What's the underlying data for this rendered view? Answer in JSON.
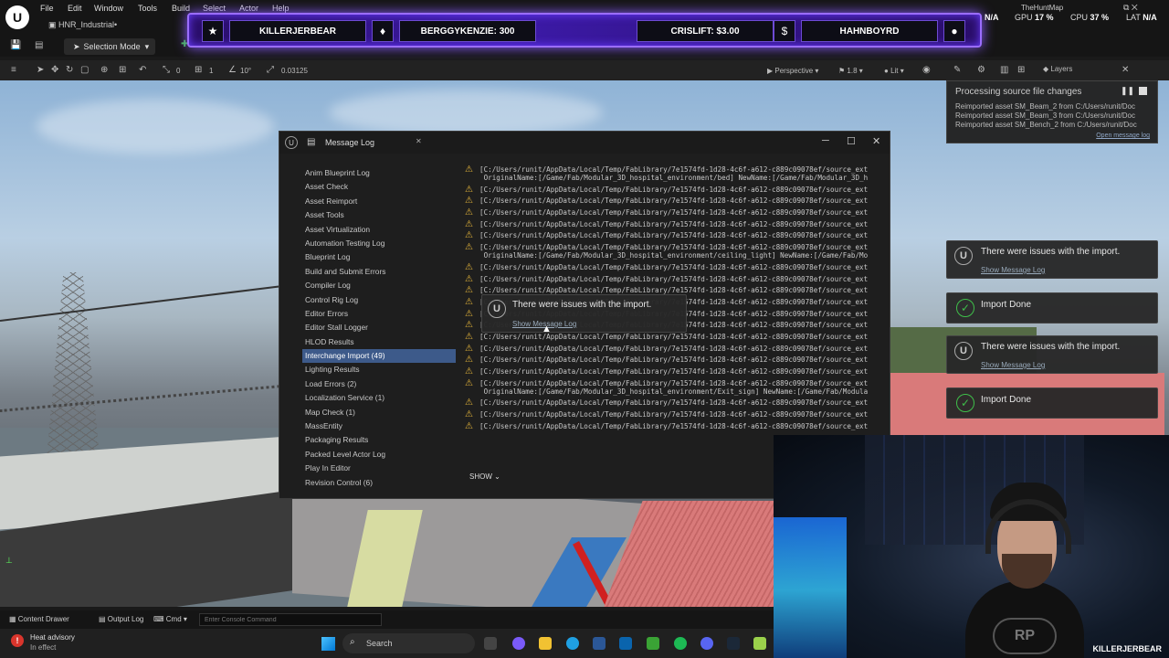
{
  "app": {
    "project_tab": "HNR_Industrial•",
    "menu": [
      "File",
      "Edit",
      "Window",
      "Tools",
      "Build",
      "Select",
      "Actor",
      "Help"
    ],
    "mode": "Selection Mode",
    "map_name": "TheHuntMap"
  },
  "toolbar": {
    "snap_grid": "0",
    "snap_rot": "1",
    "rot_step": "10°",
    "scale_step": "0.03125",
    "perspective": "Perspective",
    "cam_speed": "1.8",
    "lit": "Lit",
    "layers": "Layers"
  },
  "stats": {
    "ping_value": "N/A",
    "gpu_label": "GPU",
    "gpu_value": "17 %",
    "cpu_label": "CPU",
    "cpu_value": "37 %",
    "lat_label": "LAT",
    "lat_value": "N/A"
  },
  "banner": {
    "items": [
      "KILLERJERBEAR",
      "BERGGYKENZIE: 300",
      "CRISLIFT: $3.00",
      "HAHNBOYRD"
    ]
  },
  "message_log": {
    "title": "Message Log",
    "categories": [
      "Anim Blueprint Log",
      "Asset Check",
      "Asset Reimport",
      "Asset Tools",
      "Asset Virtualization",
      "Automation Testing Log",
      "Blueprint Log",
      "Build and Submit Errors",
      "Compiler Log",
      "Control Rig Log",
      "Editor Errors",
      "Editor Stall Logger",
      "HLOD Results",
      "Interchange Import (49)",
      "Lighting Results",
      "Load Errors (2)",
      "Localization Service (1)",
      "Map Check (1)",
      "MassEntity",
      "Packaging Results",
      "Packed Level Actor Log",
      "Play In Editor",
      "Revision Control (6)"
    ],
    "selected_index": 13,
    "lines": [
      "[C:/Users/runit/AppData/Local/Temp/FabLibrary/7e1574fd-1d28-4c6f-a612-c889c09078ef/source_ext\n OriginalName:[/Game/Fab/Modular_3D_hospital_environment/bed] NewName:[/Game/Fab/Modular_3D_h",
      "[C:/Users/runit/AppData/Local/Temp/FabLibrary/7e1574fd-1d28-4c6f-a612-c889c09078ef/source_ext",
      "[C:/Users/runit/AppData/Local/Temp/FabLibrary/7e1574fd-1d28-4c6f-a612-c889c09078ef/source_ext",
      "[C:/Users/runit/AppData/Local/Temp/FabLibrary/7e1574fd-1d28-4c6f-a612-c889c09078ef/source_ext",
      "[C:/Users/runit/AppData/Local/Temp/FabLibrary/7e1574fd-1d28-4c6f-a612-c889c09078ef/source_ext",
      "[C:/Users/runit/AppData/Local/Temp/FabLibrary/7e1574fd-1d28-4c6f-a612-c889c09078ef/source_ext",
      "[C:/Users/runit/AppData/Local/Temp/FabLibrary/7e1574fd-1d28-4c6f-a612-c889c09078ef/source_ext\n OriginalName:[/Game/Fab/Modular_3D_hospital_environment/ceiling_light] NewName:[/Game/Fab/Mo",
      "[C:/Users/runit/AppData/Local/Temp/FabLibrary/7e1574fd-1d28-4c6f-a612-c889c09078ef/source_ext",
      "[C:/Users/runit/AppData/Local/Temp/FabLibrary/7e1574fd-1d28-4c6f-a612-c889c09078ef/source_ext",
      "[C:/Users/runit/AppData/Local/Temp/FabLibrary/7e1574fd-1d28-4c6f-a612-c889c09078ef/source_ext",
      "[C:/Users/runit/AppData/Local/Temp/FabLibrary/7e1574fd-1d28-4c6f-a612-c889c09078ef/source_ext",
      "[C:/Users/runit/AppData/Local/Temp/FabLibrary/7e1574fd-1d28-4c6f-a612-c889c09078ef/source_ext",
      "[C:/Users/runit/AppData/Local/Temp/FabLibrary/7e1574fd-1d28-4c6f-a612-c889c09078ef/source_ext",
      "[C:/Users/runit/AppData/Local/Temp/FabLibrary/7e1574fd-1d28-4c6f-a612-c889c09078ef/source_ext",
      "[C:/Users/runit/AppData/Local/Temp/FabLibrary/7e1574fd-1d28-4c6f-a612-c889c09078ef/source_ext",
      "[C:/Users/runit/AppData/Local/Temp/FabLibrary/7e1574fd-1d28-4c6f-a612-c889c09078ef/source_ext",
      "[C:/Users/runit/AppData/Local/Temp/FabLibrary/7e1574fd-1d28-4c6f-a612-c889c09078ef/source_ext",
      "[C:/Users/runit/AppData/Local/Temp/FabLibrary/7e1574fd-1d28-4c6f-a612-c889c09078ef/source_ext\n OriginalName:[/Game/Fab/Modular_3D_hospital_environment/Exit_sign] NewName:[/Game/Fab/Modula",
      "[C:/Users/runit/AppData/Local/Temp/FabLibrary/7e1574fd-1d28-4c6f-a612-c889c09078ef/source_ext",
      "[C:/Users/runit/AppData/Local/Temp/FabLibrary/7e1574fd-1d28-4c6f-a612-c889c09078ef/source_ext",
      "[C:/Users/runit/AppData/Local/Temp/FabLibrary/7e1574fd-1d28-4c6f-a612-c889c09078ef/source_ext"
    ],
    "show_button": "SHOW"
  },
  "inline_toast": {
    "title": "There were issues with the import.",
    "link": "Show Message Log"
  },
  "processing": {
    "title": "Processing source file changes",
    "lines": [
      "Reimported asset SM_Beam_2 from C:/Users/runit/Doc",
      "Reimported asset SM_Beam_3 from C:/Users/runit/Doc",
      "Reimported asset SM_Bench_2 from C:/Users/runit/Doc"
    ],
    "link": "Open message log"
  },
  "notifications": [
    {
      "type": "issue",
      "title": "There were issues with the import.",
      "link": "Show Message Log"
    },
    {
      "type": "done",
      "title": "Import Done"
    },
    {
      "type": "issue",
      "title": "There were issues with the import.",
      "link": "Show Message Log"
    },
    {
      "type": "done",
      "title": "Import Done"
    }
  ],
  "bottom": {
    "content_drawer": "Content Drawer",
    "output_log": "Output Log",
    "cmd": "Cmd",
    "console_placeholder": "Enter Console Command"
  },
  "taskbar": {
    "weather_title": "Heat advisory",
    "weather_sub": "In effect",
    "search_placeholder": "Search"
  },
  "webcam": {
    "name": "KILLERJERBEAR",
    "shirt_logo": "RP"
  },
  "colors": {
    "warning": "#e2b33a",
    "selected": "#3d5a8a",
    "success": "#3fbf4a",
    "banner_glow": "#9b6dff"
  }
}
